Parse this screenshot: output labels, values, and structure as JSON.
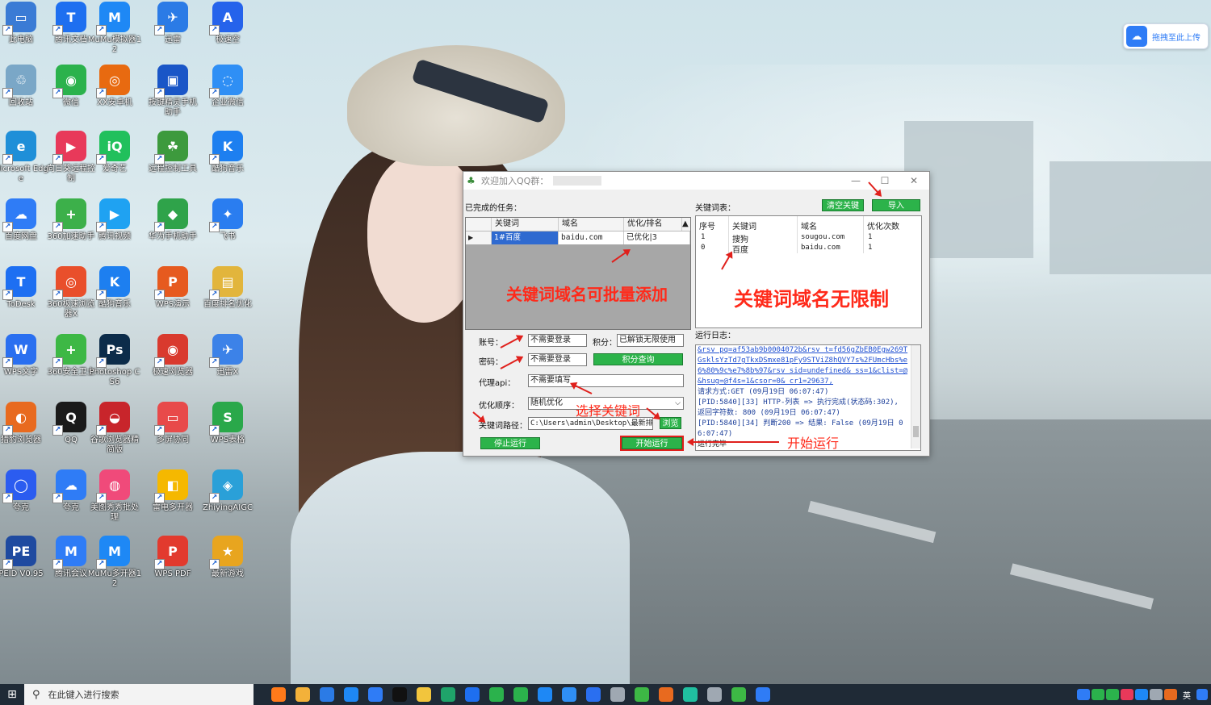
{
  "desktop": {
    "icons": [
      {
        "label": "此电脑",
        "color": "#3a7bd5",
        "glyph": "▭"
      },
      {
        "label": "腾讯文档",
        "color": "#1e6ff0",
        "glyph": "T"
      },
      {
        "label": "MuMu模拟器12",
        "color": "#1e88f5",
        "glyph": "M"
      },
      {
        "label": "迅雷",
        "color": "#2b7be6",
        "glyph": "✈"
      },
      {
        "label": "极速空",
        "color": "#2563eb",
        "glyph": "A"
      },
      {
        "label": "回收站",
        "color": "#7aa7c7",
        "glyph": "♲"
      },
      {
        "label": "微信",
        "color": "#2bb24c",
        "glyph": "◉"
      },
      {
        "label": "XX安卓机",
        "color": "#e86a10",
        "glyph": "◎"
      },
      {
        "label": "按键精灵手机助手",
        "color": "#1a56c7",
        "glyph": "▣"
      },
      {
        "label": "企业微信",
        "color": "#2f8ff5",
        "glyph": "◌"
      },
      {
        "label": "Microsoft Edge",
        "color": "#1f8fd8",
        "glyph": "e"
      },
      {
        "label": "向日葵远程控制",
        "color": "#e8395a",
        "glyph": "▶"
      },
      {
        "label": "爱奇艺",
        "color": "#21c05c",
        "glyph": "iQ"
      },
      {
        "label": "远程控制工具",
        "color": "#3d9a3d",
        "glyph": "☘"
      },
      {
        "label": "酷狗音乐",
        "color": "#1d7ff0",
        "glyph": "K"
      },
      {
        "label": "百度网盘",
        "color": "#2f7cf6",
        "glyph": "☁"
      },
      {
        "label": "360加速助手",
        "color": "#3cb04a",
        "glyph": "+"
      },
      {
        "label": "腾讯视频",
        "color": "#1fa2f2",
        "glyph": "▶"
      },
      {
        "label": "华为手机助手",
        "color": "#2fa34a",
        "glyph": "◆"
      },
      {
        "label": "飞书",
        "color": "#2a7df0",
        "glyph": "✦"
      },
      {
        "label": "ToDesk",
        "color": "#1d6ff2",
        "glyph": "T"
      },
      {
        "label": "360极速浏览器X",
        "color": "#e94f2b",
        "glyph": "◎"
      },
      {
        "label": "酷狗音乐",
        "color": "#1d7ff0",
        "glyph": "K"
      },
      {
        "label": "WPS演示",
        "color": "#e65a1f",
        "glyph": "P"
      },
      {
        "label": "百度排名优化",
        "color": "#e2b53c",
        "glyph": "▤"
      },
      {
        "label": "WPS文字",
        "color": "#2a6ff0",
        "glyph": "W"
      },
      {
        "label": "360安全卫士",
        "color": "#3db845",
        "glyph": "+"
      },
      {
        "label": "Photoshop CS6",
        "color": "#0c2c4a",
        "glyph": "Ps"
      },
      {
        "label": "极速浏览器",
        "color": "#d93a2e",
        "glyph": "◉"
      },
      {
        "label": "迅雷X",
        "color": "#3c82e8",
        "glyph": "✈"
      },
      {
        "label": "猎豹浏览器",
        "color": "#e86a1f",
        "glyph": "◐"
      },
      {
        "label": "QQ",
        "color": "#1a1a1a",
        "glyph": "Q"
      },
      {
        "label": "谷歌浏览器精简版",
        "color": "#c8252b",
        "glyph": "◒"
      },
      {
        "label": "多屏协同",
        "color": "#e84a4a",
        "glyph": "▭"
      },
      {
        "label": "WPS表格",
        "color": "#2aa84a",
        "glyph": "S"
      },
      {
        "label": "夸克",
        "color": "#2b5cf0",
        "glyph": "◯"
      },
      {
        "label": "夸克",
        "color": "#2f7cf6",
        "glyph": "☁"
      },
      {
        "label": "美图秀秀批处理",
        "color": "#f04a7a",
        "glyph": "◍"
      },
      {
        "label": "雷电多开器",
        "color": "#f5b800",
        "glyph": "◧"
      },
      {
        "label": "ZhiyingAIGC",
        "color": "#2aa0d8",
        "glyph": "◈"
      },
      {
        "label": "PEID V0.95",
        "color": "#1f4aa0",
        "glyph": "PE"
      },
      {
        "label": "腾讯会议",
        "color": "#2f7cf6",
        "glyph": "M"
      },
      {
        "label": "MuMu多开器12",
        "color": "#1e88f5",
        "glyph": "M"
      },
      {
        "label": "WPS PDF",
        "color": "#e23a2e",
        "glyph": "P"
      },
      {
        "label": "最新游戏",
        "color": "#e8a51f",
        "glyph": "★"
      }
    ],
    "upload_widget": {
      "label": "拖拽至此上传",
      "glyph": "☁"
    }
  },
  "window": {
    "title": "欢迎加入QQ群：",
    "minimize": "—",
    "maximize": "☐",
    "close": "✕",
    "completed_tasks_label": "已完成的任务：",
    "tasks_headers": [
      "关键词",
      "域名",
      "优化/排名"
    ],
    "tasks_rows": [
      {
        "marker": "▶",
        "keyword": "1#百度",
        "domain": "baidu.com",
        "status": "已优化|3"
      }
    ],
    "keyword_list_label": "关键词表：",
    "clear_button": "清空关键",
    "import_button": "导入",
    "kw_headers": [
      "序号",
      "关键词",
      "域名",
      "优化次数"
    ],
    "kw_rows": [
      {
        "index": "1",
        "keyword": "搜狗",
        "domain": "sougou.com",
        "count": "1"
      },
      {
        "index": "0",
        "keyword": "百度",
        "domain": "baidu.com",
        "count": "1"
      }
    ],
    "account_label": "账号：",
    "account_value": "不需要登录",
    "points_label": "积分：",
    "points_value": "已解锁无限使用",
    "password_label": "密码：",
    "password_value": "不需要登录",
    "points_query_button": "积分查询",
    "proxy_label": "代理api：",
    "proxy_value": "不需要填写",
    "order_label": "优化顺序：",
    "order_value": "随机优化",
    "path_label": "关键词路径：",
    "path_value": "C:\\Users\\admin\\Desktop\\最新排名",
    "browse_button": "浏览",
    "stop_button": "停止运行",
    "start_button": "开始运行",
    "log_label": "运行日志：",
    "log_lines": [
      {
        "text": "&rsv_pq=af53ab9b0004072b&rsv_t=fd56gZbEB0Egw269TGsklsYzTd7gTkxDSmxe81pFy9STViZ8hQVY7s%2FUmcHbs%e6%80%9c%e7%8b%97&rsv_sid=undefined&_ss=1&clist=@&hsug=@f4s=1&csor=0&_cr1=29637,",
        "link": true
      },
      {
        "text": "请求方式:GET (09月19日 06:07:47)",
        "link": false
      },
      {
        "text": "[PID:5840][33] HTTP-列表 => 执行完成(状态码:302), 返回字符数: 800 (09月19日 06:07:47)",
        "link": false
      },
      {
        "text": "[PID:5840][34] 判断200 => 结果: False (09月19日 06:07:47)",
        "link": false
      }
    ],
    "log_done": "运行完毕"
  },
  "annotations": {
    "batch_add": "关键词域名可批量添加",
    "unlimited": "关键词域名无限制",
    "select_keyword": "选择关键词",
    "start_run": "开始运行"
  },
  "taskbar": {
    "start_glyph": "⊞",
    "search_placeholder": "在此键入进行搜索",
    "search_glyph": "⚲",
    "apps": [
      "#ff7a1a",
      "#f3b13a",
      "#2b7be6",
      "#1e88f5",
      "#2f7cf6",
      "#111111",
      "#f2c53d",
      "#1fa36a",
      "#1e6ff0",
      "#2bb24c",
      "#2bb24c",
      "#1e88f5",
      "#2f8ff5",
      "#2a6ff0",
      "#9fa8b2",
      "#3db845",
      "#e86a1f",
      "#20c0a0",
      "#9fa8b2",
      "#3db845",
      "#2f7cf6"
    ],
    "tray_lang": "英"
  }
}
